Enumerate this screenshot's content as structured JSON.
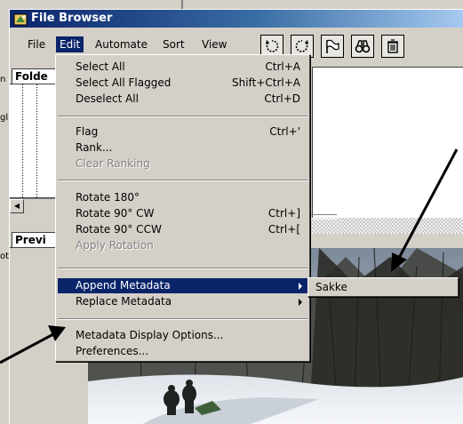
{
  "window": {
    "title": "File Browser"
  },
  "behind_fragments": [
    "n",
    "gl",
    "ot"
  ],
  "menubar": [
    {
      "label": "File",
      "active": false
    },
    {
      "label": "Edit",
      "active": true
    },
    {
      "label": "Automate",
      "active": false
    },
    {
      "label": "Sort",
      "active": false
    },
    {
      "label": "View",
      "active": false
    }
  ],
  "toolbar": [
    {
      "icon": "rotate-ccw-icon"
    },
    {
      "icon": "rotate-cw-icon"
    },
    {
      "icon": "flag-icon"
    },
    {
      "icon": "binoculars-icon"
    },
    {
      "icon": "trash-icon"
    }
  ],
  "panels": {
    "folders_tab": "Folde",
    "preview_tab": "Previ"
  },
  "edit_menu": {
    "items": [
      {
        "label": "Select All",
        "shortcut": "Ctrl+A"
      },
      {
        "label": "Select All Flagged",
        "shortcut": "Shift+Ctrl+A"
      },
      {
        "label": "Deselect All",
        "shortcut": "Ctrl+D"
      },
      {
        "label": "Flag",
        "shortcut": "Ctrl+'"
      },
      {
        "label": "Rank...",
        "shortcut": ""
      },
      {
        "label": "Clear Ranking",
        "shortcut": "",
        "disabled": true
      },
      {
        "label": "Rotate 180°",
        "shortcut": ""
      },
      {
        "label": "Rotate 90° CW",
        "shortcut": "Ctrl+]"
      },
      {
        "label": "Rotate 90° CCW",
        "shortcut": "Ctrl+["
      },
      {
        "label": "Apply Rotation",
        "shortcut": "",
        "disabled": true
      },
      {
        "label": "Append Metadata",
        "shortcut": "",
        "submenu": true,
        "selected": true
      },
      {
        "label": "Replace Metadata",
        "shortcut": "",
        "submenu": true
      },
      {
        "label": "Metadata Display Options...",
        "shortcut": ""
      },
      {
        "label": "Preferences...",
        "shortcut": ""
      }
    ]
  },
  "submenu": {
    "items": [
      "Sakke"
    ]
  },
  "colors": {
    "selection": "#0a246a",
    "face": "#d4d0c8",
    "disabled": "#808080"
  }
}
